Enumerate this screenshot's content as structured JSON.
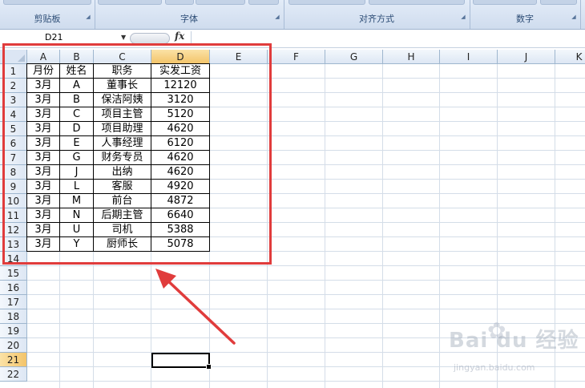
{
  "ribbon": {
    "groups": [
      {
        "label": "剪贴板"
      },
      {
        "label": "字体"
      },
      {
        "label": "对齐方式"
      },
      {
        "label": "数字"
      }
    ],
    "launcher_glyph": "◢"
  },
  "formula_bar": {
    "name_box": "D21",
    "fx_label": "fx",
    "formula": ""
  },
  "sheet": {
    "columns": [
      "A",
      "B",
      "C",
      "D",
      "E",
      "F",
      "G",
      "H",
      "I",
      "J",
      "K"
    ],
    "rows": [
      "1",
      "2",
      "3",
      "4",
      "5",
      "6",
      "7",
      "8",
      "9",
      "10",
      "11",
      "12",
      "13",
      "14",
      "15",
      "16",
      "17",
      "18",
      "19",
      "20",
      "21",
      "22"
    ],
    "selected_column": "D",
    "selected_row": "21",
    "active_cell": "D21",
    "table": {
      "header": [
        "月份",
        "姓名",
        "职务",
        "实发工资"
      ],
      "rows": [
        [
          "3月",
          "A",
          "董事长",
          "12120"
        ],
        [
          "3月",
          "B",
          "保洁阿姨",
          "3120"
        ],
        [
          "3月",
          "C",
          "项目主管",
          "5120"
        ],
        [
          "3月",
          "D",
          "项目助理",
          "4620"
        ],
        [
          "3月",
          "E",
          "人事经理",
          "6120"
        ],
        [
          "3月",
          "G",
          "财务专员",
          "4620"
        ],
        [
          "3月",
          "J",
          "出纳",
          "4620"
        ],
        [
          "3月",
          "L",
          "客服",
          "4920"
        ],
        [
          "3月",
          "M",
          "前台",
          "4872"
        ],
        [
          "3月",
          "N",
          "后期主管",
          "6640"
        ],
        [
          "3月",
          "U",
          "司机",
          "5388"
        ],
        [
          "3月",
          "Y",
          "厨师长",
          "5078"
        ]
      ]
    }
  },
  "annotation": {
    "highlight_color": "#e03c3c"
  },
  "watermark": {
    "logo": "Bai du 经验",
    "url": "jingyan.baidu.com"
  }
}
